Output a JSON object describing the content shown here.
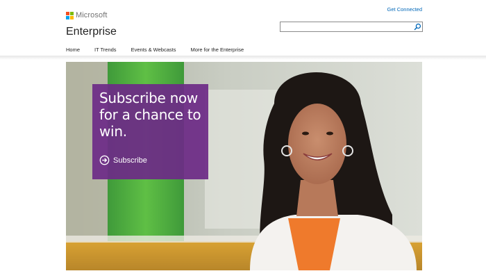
{
  "brand": {
    "name": "Microsoft",
    "logo_colors": [
      "#f25022",
      "#7fba00",
      "#00a4ef",
      "#ffb900"
    ]
  },
  "header": {
    "get_connected": "Get Connected",
    "site_title": "Enterprise",
    "search": {
      "value": "",
      "placeholder": "",
      "icon": "search-icon"
    }
  },
  "nav": {
    "items": [
      {
        "label": "Home"
      },
      {
        "label": "IT Trends"
      },
      {
        "label": "Events & Webcasts"
      },
      {
        "label": "More for the Enterprise"
      }
    ]
  },
  "hero": {
    "promo": {
      "headline": "Subscribe now for a chance to win.",
      "cta_label": "Subscribe",
      "cta_icon": "arrow-circle-right-icon",
      "background": "#6d2b86"
    }
  },
  "colors": {
    "link": "#0067b8",
    "accent": "#6d2b86"
  }
}
